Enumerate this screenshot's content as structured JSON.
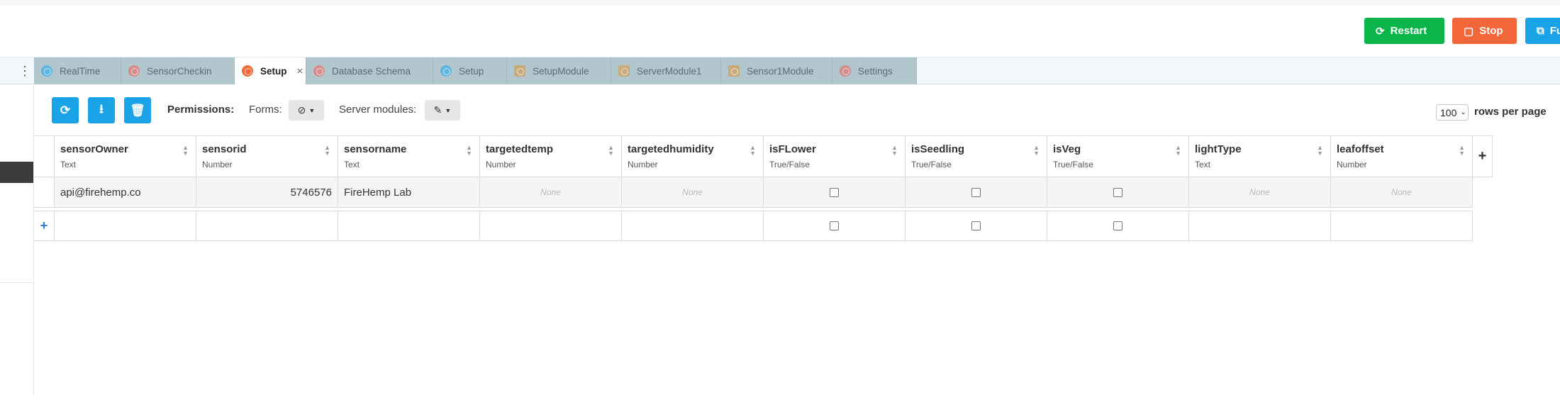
{
  "header": {
    "restart_label": "Restart",
    "stop_label": "Stop",
    "fullscreen_label": "Fu",
    "colors": {
      "restart": "#0cb54a",
      "stop": "#f2673a",
      "fullscreen": "#1aa3e6"
    }
  },
  "tabs": [
    {
      "label": "RealTime",
      "icon": "globe-icon",
      "active": false
    },
    {
      "label": "SensorCheckin",
      "icon": "database-icon",
      "active": false
    },
    {
      "label": "Setup",
      "icon": "database-icon",
      "active": true,
      "close": "×"
    },
    {
      "label": "Database Schema",
      "icon": "database-icon",
      "active": false
    },
    {
      "label": "Setup",
      "icon": "globe-icon",
      "active": false
    },
    {
      "label": "SetupModule",
      "icon": "module-icon",
      "active": false
    },
    {
      "label": "ServerModule1",
      "icon": "module-icon",
      "active": false
    },
    {
      "label": "Sensor1Module",
      "icon": "module-icon",
      "active": false
    },
    {
      "label": "Settings",
      "icon": "gear-icon",
      "active": false
    }
  ],
  "toolbar": {
    "permissions_label": "Permissions:",
    "forms_label": "Forms:",
    "server_modules_label": "Server modules:",
    "rows_per_page_value": "100",
    "rows_per_page_label": "rows per page"
  },
  "table": {
    "columns": [
      {
        "name": "sensorOwner",
        "type": "Text"
      },
      {
        "name": "sensorid",
        "type": "Number"
      },
      {
        "name": "sensorname",
        "type": "Text"
      },
      {
        "name": "targetedtemp",
        "type": "Number"
      },
      {
        "name": "targetedhumidity",
        "type": "Number"
      },
      {
        "name": "isFLower",
        "type": "True/False"
      },
      {
        "name": "isSeedling",
        "type": "True/False"
      },
      {
        "name": "isVeg",
        "type": "True/False"
      },
      {
        "name": "lightType",
        "type": "Text"
      },
      {
        "name": "leafoffset",
        "type": "Number"
      }
    ],
    "rows": [
      [
        "api@firehemp.co",
        "5746576",
        "FireHemp Lab",
        "None",
        "None",
        false,
        false,
        false,
        "None",
        "None"
      ]
    ]
  }
}
